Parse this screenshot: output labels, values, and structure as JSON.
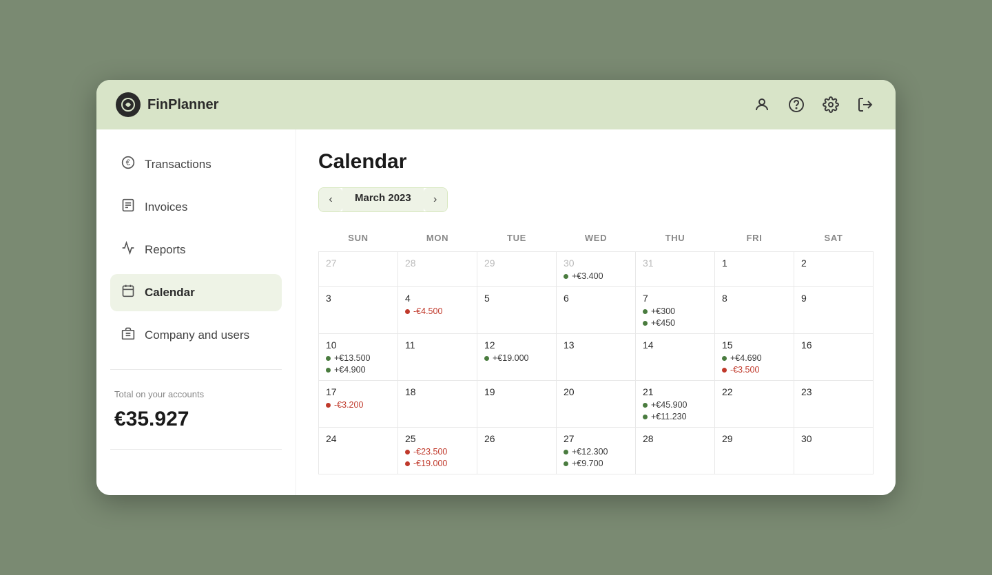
{
  "app": {
    "name": "FinPlanner",
    "logo_char": "🌿"
  },
  "header": {
    "icons": [
      "person",
      "help",
      "settings",
      "logout"
    ]
  },
  "sidebar": {
    "items": [
      {
        "id": "transactions",
        "label": "Transactions",
        "icon": "€",
        "active": false
      },
      {
        "id": "invoices",
        "label": "Invoices",
        "icon": "🧾",
        "active": false
      },
      {
        "id": "reports",
        "label": "Reports",
        "icon": "📈",
        "active": false
      },
      {
        "id": "calendar",
        "label": "Calendar",
        "icon": "📅",
        "active": true
      },
      {
        "id": "company",
        "label": "Company and users",
        "icon": "🏢",
        "active": false
      }
    ],
    "account_label": "Total on your accounts",
    "account_value": "€35.927"
  },
  "calendar": {
    "title": "Calendar",
    "month_label": "March 2023",
    "days_of_week": [
      "SUN",
      "MON",
      "TUE",
      "WED",
      "THU",
      "FRI",
      "SAT"
    ],
    "rows": [
      [
        {
          "num": "27",
          "other": true,
          "entries": []
        },
        {
          "num": "28",
          "other": true,
          "entries": []
        },
        {
          "num": "29",
          "other": true,
          "entries": []
        },
        {
          "num": "30",
          "other": true,
          "entries": [
            {
              "type": "green",
              "text": "+€3.400"
            }
          ]
        },
        {
          "num": "31",
          "other": true,
          "entries": []
        },
        {
          "num": "1",
          "other": false,
          "entries": []
        },
        {
          "num": "2",
          "other": false,
          "entries": []
        }
      ],
      [
        {
          "num": "3",
          "other": false,
          "entries": []
        },
        {
          "num": "4",
          "other": false,
          "entries": [
            {
              "type": "red",
              "text": "-€4.500"
            }
          ]
        },
        {
          "num": "5",
          "other": false,
          "entries": []
        },
        {
          "num": "6",
          "other": false,
          "entries": []
        },
        {
          "num": "7",
          "other": false,
          "entries": [
            {
              "type": "green",
              "text": "+€300"
            },
            {
              "type": "green",
              "text": "+€450"
            }
          ]
        },
        {
          "num": "8",
          "other": false,
          "entries": []
        },
        {
          "num": "9",
          "other": false,
          "entries": []
        }
      ],
      [
        {
          "num": "10",
          "other": false,
          "entries": [
            {
              "type": "green",
              "text": "+€13.500"
            },
            {
              "type": "green",
              "text": "+€4.900"
            }
          ]
        },
        {
          "num": "11",
          "other": false,
          "entries": []
        },
        {
          "num": "12",
          "other": false,
          "entries": [
            {
              "type": "green",
              "text": "+€19.000"
            }
          ]
        },
        {
          "num": "13",
          "other": false,
          "entries": []
        },
        {
          "num": "14",
          "other": false,
          "entries": []
        },
        {
          "num": "15",
          "other": false,
          "entries": [
            {
              "type": "green",
              "text": "+€4.690"
            },
            {
              "type": "red",
              "text": "-€3.500"
            }
          ]
        },
        {
          "num": "16",
          "other": false,
          "entries": []
        }
      ],
      [
        {
          "num": "17",
          "other": false,
          "entries": [
            {
              "type": "red",
              "text": "-€3.200"
            }
          ]
        },
        {
          "num": "18",
          "other": false,
          "entries": []
        },
        {
          "num": "19",
          "other": false,
          "entries": []
        },
        {
          "num": "20",
          "other": false,
          "entries": []
        },
        {
          "num": "21",
          "other": false,
          "entries": [
            {
              "type": "green",
              "text": "+€45.900"
            },
            {
              "type": "green",
              "text": "+€11.230"
            }
          ]
        },
        {
          "num": "22",
          "other": false,
          "entries": []
        },
        {
          "num": "23",
          "other": false,
          "entries": []
        }
      ],
      [
        {
          "num": "24",
          "other": false,
          "entries": []
        },
        {
          "num": "25",
          "other": false,
          "entries": [
            {
              "type": "red",
              "text": "-€23.500"
            },
            {
              "type": "red",
              "text": "-€19.000"
            }
          ]
        },
        {
          "num": "26",
          "other": false,
          "entries": []
        },
        {
          "num": "27",
          "other": false,
          "entries": [
            {
              "type": "green",
              "text": "+€12.300"
            },
            {
              "type": "green",
              "text": "+€9.700"
            }
          ]
        },
        {
          "num": "28",
          "other": false,
          "entries": []
        },
        {
          "num": "29",
          "other": false,
          "entries": []
        },
        {
          "num": "30",
          "other": false,
          "entries": []
        }
      ]
    ]
  }
}
